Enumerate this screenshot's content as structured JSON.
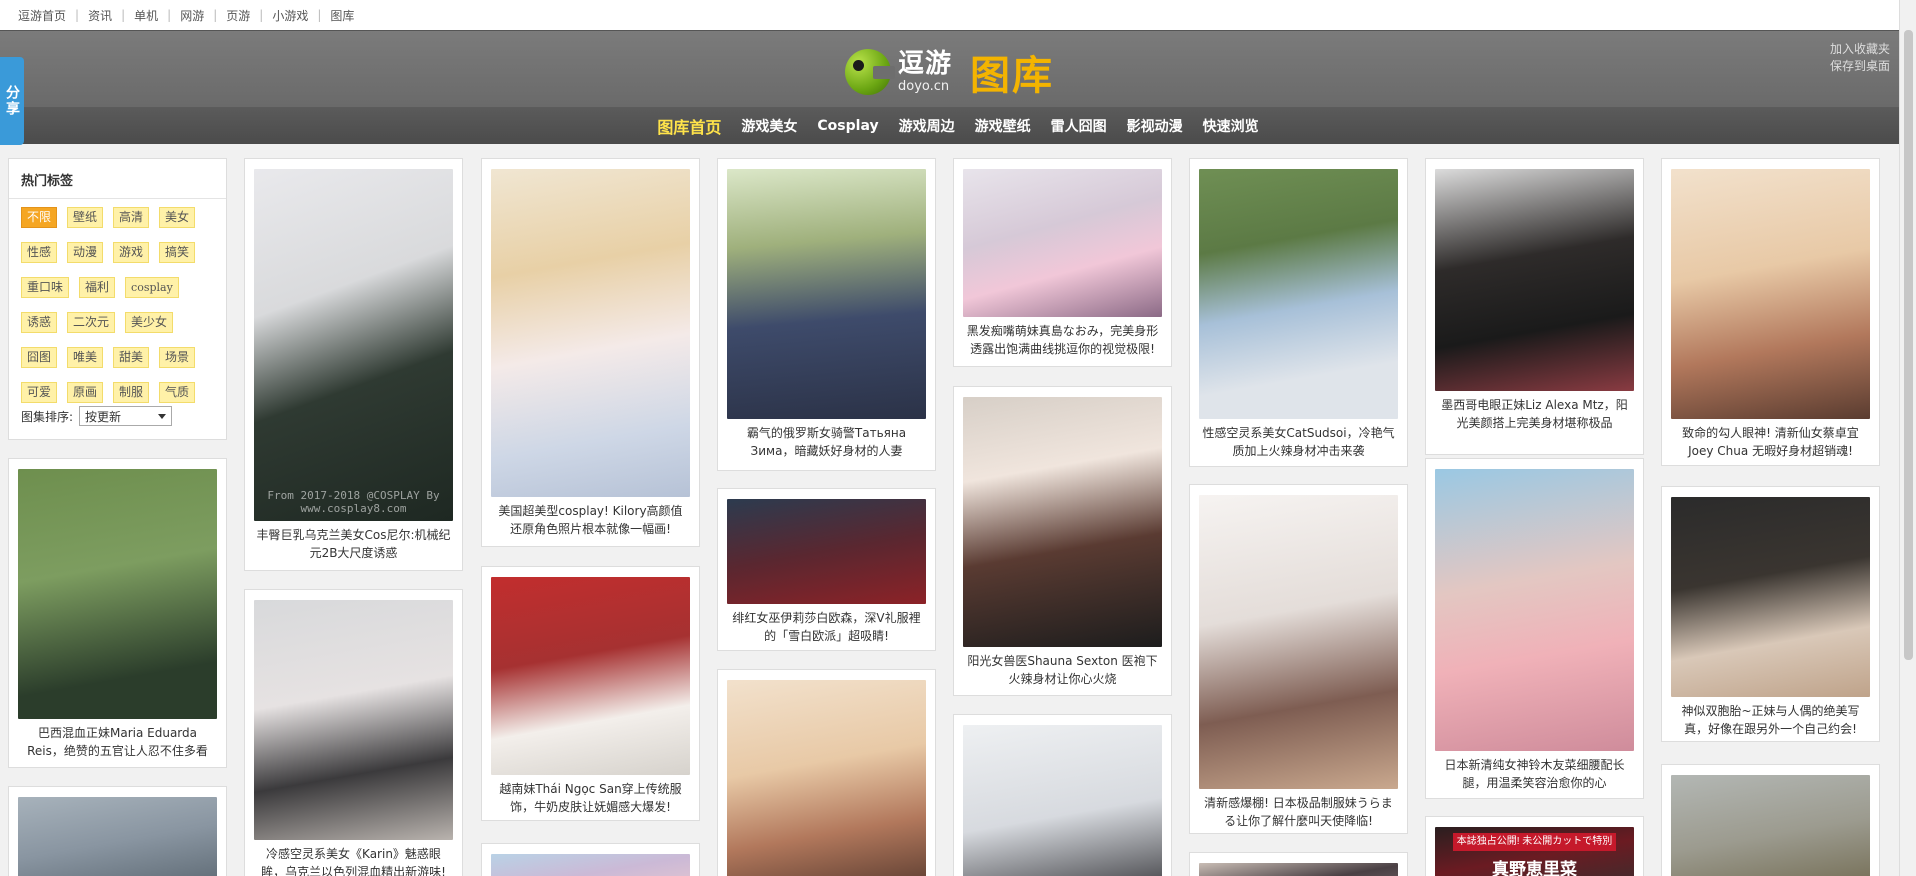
{
  "topnav": [
    "逗游首页",
    "资讯",
    "单机",
    "网游",
    "页游",
    "小游戏",
    "图库"
  ],
  "banner": {
    "logo_cn": "逗游",
    "logo_en": "doyo.cn",
    "logo_tuku": "图库",
    "bookmark": "加入收藏夹",
    "save_desktop": "保存到桌面"
  },
  "share_label": "分享",
  "catnav": [
    "图库首页",
    "游戏美女",
    "Cosplay",
    "游戏周边",
    "游戏壁纸",
    "雷人囧图",
    "影视动漫",
    "快速浏览"
  ],
  "tags": {
    "title": "热门标签",
    "items": [
      "不限",
      "壁纸",
      "高清",
      "美女",
      "性感",
      "动漫",
      "游戏",
      "搞笑",
      "重口味",
      "福利",
      "cosplay",
      "诱惑",
      "二次元",
      "美少女",
      "囧图",
      "唯美",
      "甜美",
      "场景",
      "可爱",
      "原画",
      "制服",
      "气质"
    ],
    "sort_label": "图集排序:",
    "sort_value": "按更新"
  },
  "cards": [
    {
      "caption": "巴西混血正妹Maria Eduarda Reis，绝赞的五官让人忍不住多看"
    },
    {
      "caption": ""
    },
    {
      "caption": "丰臀巨乳乌克兰美女Cos尼尔:机械纪元2B大尺度诱惑",
      "watermark": "From 2017-2018 @COSPLAY By www.cosplay8.com"
    },
    {
      "caption": "冷感空灵系美女《Karin》魅惑眼眸，乌克兰以色列混血精出新游味!"
    },
    {
      "caption": "美国超美型cosplay! Kilory高颜值还原角色照片根本就像一幅画!"
    },
    {
      "caption": "越南妹Thái Ngọc San穿上传统服饰，牛奶皮肤让妩媚感大爆发!"
    },
    {
      "caption": ""
    },
    {
      "caption": "霸气的俄罗斯女骑警Татьяна Зима，暗藏妖好身材的人妻"
    },
    {
      "caption": "绯红女巫伊莉莎白欧森，深V礼服裡的「雪白欧派」超吸睛!"
    },
    {
      "caption": ""
    },
    {
      "caption": "黑发痴嘴萌妹真島なおみ，完美身形透露出饱满曲线挑逗你的视觉极限!"
    },
    {
      "caption": "阳光女兽医Shauna Sexton 医袍下火辣身材让你心火烧"
    },
    {
      "caption": ""
    },
    {
      "caption": "性感空灵系美女CatSudsoi，冷艳气质加上火辣身材冲击来袭"
    },
    {
      "caption": "清新感爆棚! 日本极品制服妹うらまる让你了解什麼叫天使降临!"
    },
    {
      "caption": ""
    },
    {
      "caption": "墨西哥电眼正妹Liz Alexa Mtz，阳光美颜搭上完美身材堪称极品"
    },
    {
      "caption": "日本新清纯女神铃木友菜细腰配长腿，用温柔笑容治愈你的心"
    },
    {
      "caption": "",
      "banner_text": "本誌独占公開! 未公開カットで特別",
      "jp_text": "真野恵里菜"
    },
    {
      "caption": "致命的勾人眼神! 清新仙女蔡卓宜Joey Chua 无暇好身材超销魂!"
    },
    {
      "caption": "神似双胞胎~正妹与人偶的绝美写真，好像在跟另外一个自己约会!"
    },
    {
      "caption": ""
    }
  ]
}
